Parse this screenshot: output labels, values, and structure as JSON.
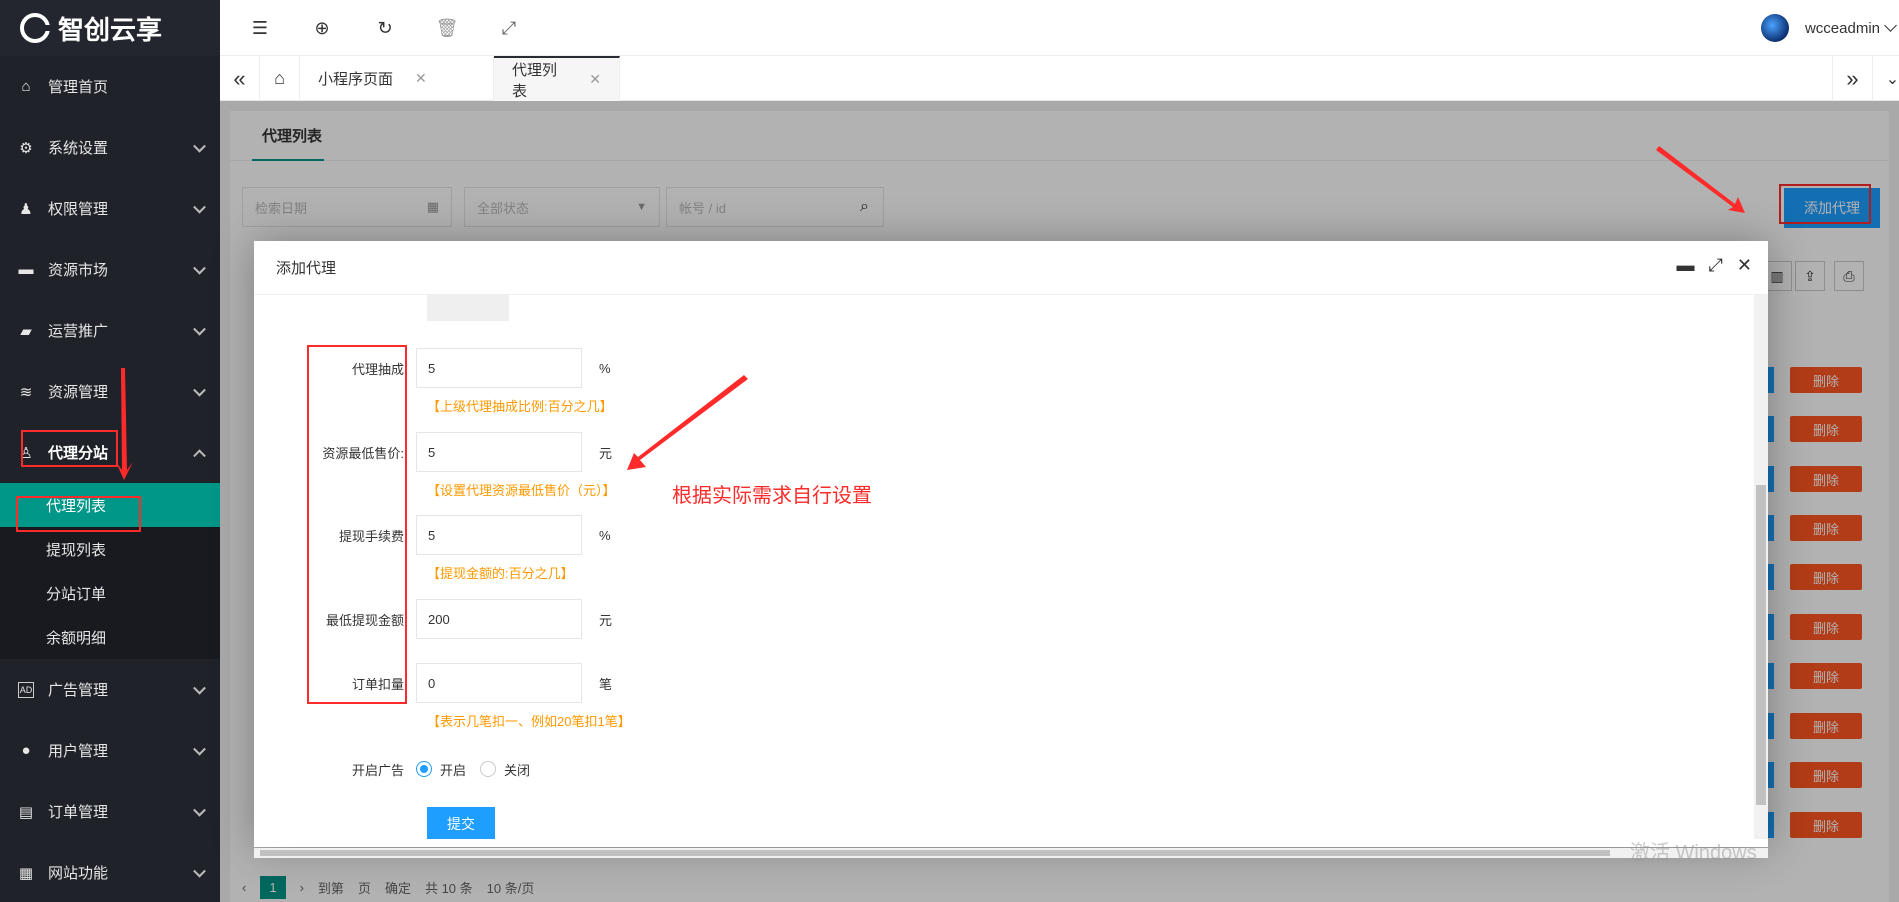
{
  "app": {
    "logo_text": "智创云享"
  },
  "sidebar": {
    "items": [
      {
        "label": "管理首页",
        "icon": "home-icon"
      },
      {
        "label": "系统设置",
        "icon": "gear-icon"
      },
      {
        "label": "权限管理",
        "icon": "users-icon"
      },
      {
        "label": "资源市场",
        "icon": "store-icon"
      },
      {
        "label": "运营推广",
        "icon": "flag-icon"
      },
      {
        "label": "资源管理",
        "icon": "layers-icon"
      },
      {
        "label": "代理分站",
        "icon": "user-icon"
      }
    ],
    "sub_items": [
      "代理列表",
      "提现列表",
      "分站订单",
      "余额明细"
    ],
    "items_after": [
      {
        "label": "广告管理",
        "icon": "ad-icon"
      },
      {
        "label": "用户管理",
        "icon": "person-icon"
      },
      {
        "label": "订单管理",
        "icon": "clipboard-icon"
      },
      {
        "label": "网站功能",
        "icon": "grid-icon"
      }
    ]
  },
  "header": {
    "username": "wcceadmin"
  },
  "tabs": [
    {
      "label": "小程序页面"
    },
    {
      "label": "代理列表"
    }
  ],
  "page": {
    "title": "代理列表",
    "filters": {
      "date_placeholder": "检索日期",
      "status_placeholder": "全部状态",
      "account_placeholder": "帐号 / id"
    },
    "add_button": "添加代理",
    "delete_label": "删除",
    "pager": {
      "current": "1",
      "items": [
        "到第",
        "页",
        "确定",
        "共 10 条",
        "10 条/页"
      ]
    }
  },
  "modal": {
    "title": "添加代理",
    "fields": [
      {
        "label": "代理抽成",
        "value": "5",
        "unit": "%",
        "hint": "【上级代理抽成比例:百分之几】"
      },
      {
        "label": "资源最低售价:",
        "value": "5",
        "unit": "元",
        "hint": "【设置代理资源最低售价（元）】"
      },
      {
        "label": "提现手续费",
        "value": "5",
        "unit": "%",
        "hint": "【提现金额的:百分之几】"
      },
      {
        "label": "最低提现金额",
        "value": "200",
        "unit": "元",
        "hint": ""
      },
      {
        "label": "订单扣量",
        "value": "0",
        "unit": "笔",
        "hint": "【表示几笔扣一、例如20笔扣1笔】"
      }
    ],
    "ad": {
      "label": "开启广告",
      "options": [
        "开启",
        "关闭"
      ],
      "selected": "开启"
    },
    "submit": "提交"
  },
  "annotation": {
    "text": "根据实际需求自行设置"
  },
  "watermark": "激活 Windows"
}
